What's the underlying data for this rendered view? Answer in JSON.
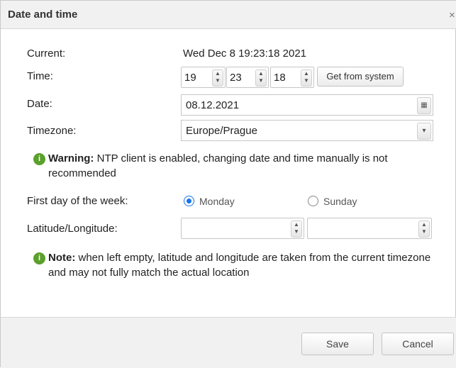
{
  "dialog": {
    "title": "Date and time",
    "close_glyph": "×"
  },
  "current": {
    "label": "Current:",
    "value": "Wed Dec 8 19:23:18 2021"
  },
  "time": {
    "label": "Time:",
    "hour": "19",
    "minute": "23",
    "second": "18",
    "get_from_system": "Get from system"
  },
  "date": {
    "label": "Date:",
    "value": "08.12.2021",
    "calendar_icon": "calendar-icon"
  },
  "timezone": {
    "label": "Timezone:",
    "value": "Europe/Prague",
    "dropdown_icon": "chevron-down-icon"
  },
  "warning": {
    "icon": "info-icon",
    "bold": "Warning:",
    "text": " NTP client is enabled, changing date and time manually is not recommended"
  },
  "first_day": {
    "label": "First day of the week:",
    "options": [
      "Monday",
      "Sunday"
    ],
    "selected": "Monday"
  },
  "latlon": {
    "label": "Latitude/Longitude:",
    "latitude": "",
    "longitude": ""
  },
  "note": {
    "icon": "info-icon",
    "bold": "Note:",
    "text": " when left empty, latitude and longitude are taken from the current timezone and may not fully match the actual location"
  },
  "footer": {
    "save": "Save",
    "cancel": "Cancel"
  },
  "colors": {
    "accent": "#1a73e8",
    "info_icon": "#5aa02c",
    "titlebar": "#f1f1f1"
  }
}
